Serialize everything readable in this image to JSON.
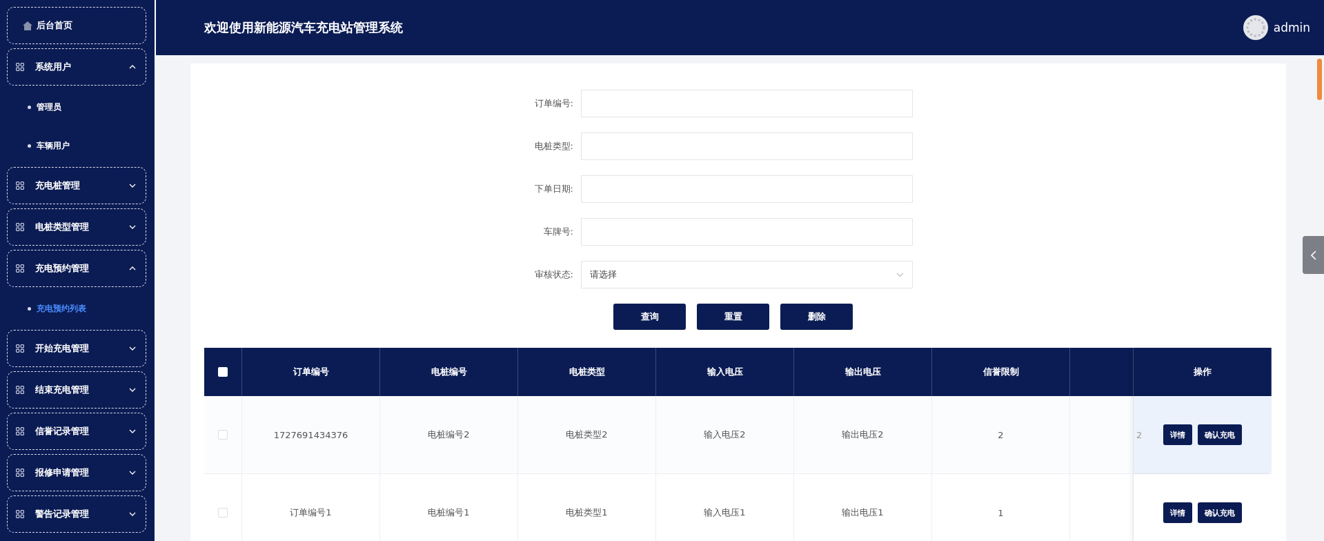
{
  "sidebar": {
    "items": [
      {
        "label": "后台首页",
        "kind": "home"
      },
      {
        "label": "系统用户",
        "kind": "group",
        "expanded": true,
        "children": [
          {
            "label": "管理员",
            "selected": false
          },
          {
            "label": "车辆用户",
            "selected": false
          }
        ]
      },
      {
        "label": "充电桩管理",
        "kind": "group",
        "expanded": false
      },
      {
        "label": "电桩类型管理",
        "kind": "group",
        "expanded": false
      },
      {
        "label": "充电预约管理",
        "kind": "group",
        "expanded": true,
        "children": [
          {
            "label": "充电预约列表",
            "selected": true
          }
        ]
      },
      {
        "label": "开始充电管理",
        "kind": "group",
        "expanded": false
      },
      {
        "label": "结束充电管理",
        "kind": "group",
        "expanded": false
      },
      {
        "label": "信誉记录管理",
        "kind": "group",
        "expanded": false
      },
      {
        "label": "报修申请管理",
        "kind": "group",
        "expanded": false
      },
      {
        "label": "警告记录管理",
        "kind": "group",
        "expanded": false
      }
    ]
  },
  "header": {
    "title": "欢迎使用新能源汽车充电站管理系统",
    "user": "admin"
  },
  "search": {
    "fields": [
      {
        "label": "订单编号:",
        "kind": "input"
      },
      {
        "label": "电桩类型:",
        "kind": "input"
      },
      {
        "label": "下单日期:",
        "kind": "input"
      },
      {
        "label": "车牌号:",
        "kind": "input"
      },
      {
        "label": "审核状态:",
        "kind": "select",
        "placeholder": "请选择"
      }
    ],
    "buttons": [
      "查询",
      "重置",
      "删除"
    ]
  },
  "table": {
    "all_checked": false,
    "columns": [
      "订单编号",
      "电桩编号",
      "电桩类型",
      "输入电压",
      "输出电压",
      "信誉限制"
    ],
    "action_header": "操作",
    "rows": [
      {
        "checked": false,
        "hovered": true,
        "cells": [
          "1727691434376",
          "电桩编号2",
          "电桩类型2",
          "输入电压2",
          "输出电压2",
          "2"
        ],
        "peek": "2",
        "actions": [
          "详情",
          "确认充电"
        ]
      },
      {
        "checked": false,
        "hovered": false,
        "cells": [
          "订单编号1",
          "电桩编号1",
          "电桩类型1",
          "输入电压1",
          "输出电压1",
          "1"
        ],
        "actions": [
          "详情",
          "确认充电"
        ]
      }
    ]
  }
}
